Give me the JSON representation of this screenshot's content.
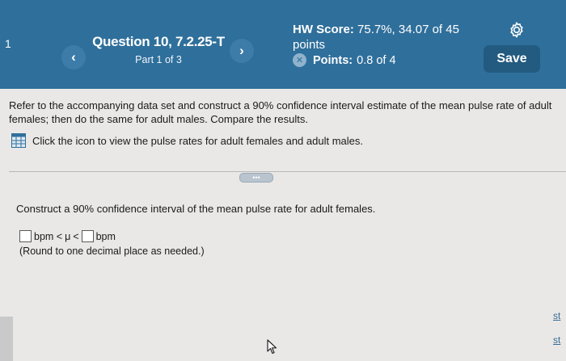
{
  "header": {
    "left_glyph": "1",
    "prev_label": "‹",
    "next_label": "›",
    "question_title": "Question 10, 7.2.25-T",
    "part_label": "Part 1 of 3",
    "hw_score_label": "HW Score:",
    "hw_score_value": "75.7%, 34.07 of 45",
    "hw_score_unit": "points",
    "points_label": "Points:",
    "points_value": "0.8 of 4",
    "save_label": "Save",
    "colors": {
      "bar": "#2f6f9b",
      "save_button": "#235a80"
    }
  },
  "content": {
    "intro": "Refer to the accompanying data set and construct a 90% confidence interval estimate of the mean pulse rate of adult females; then do the same for adult males. Compare the results.",
    "data_link": "Click the icon to view the pulse rates for adult females and adult males.",
    "more_label": "•••",
    "question": "Construct a 90% confidence interval of the mean pulse rate for adult females.",
    "answer": {
      "unit_1": "bpm <",
      "mu": "μ",
      "lt": "<",
      "unit_2": "bpm",
      "value_1": "",
      "value_2": ""
    },
    "round_note": "(Round to one decimal place as needed.)"
  },
  "edge": {
    "text_1": "st",
    "text_2": "st"
  }
}
